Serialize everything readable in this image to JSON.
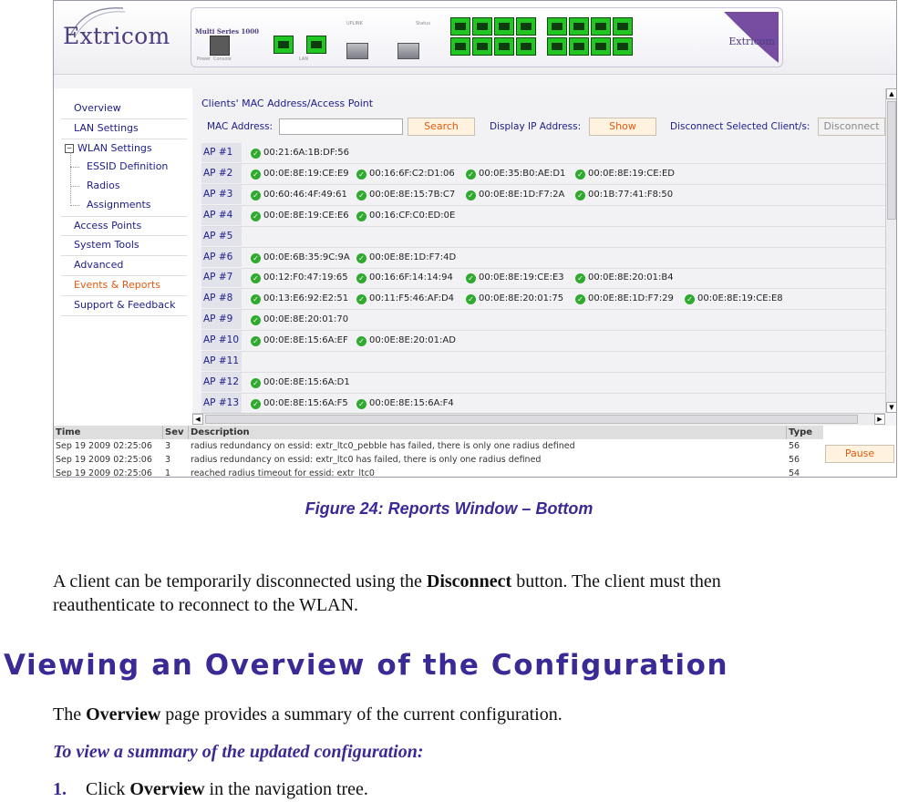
{
  "banner": {
    "logo": "Extricom",
    "device_title": "Multi Series 1000",
    "device_logo": "Extricom",
    "device_labels": [
      "Power",
      "Console",
      "LAN",
      "UPLINK",
      "Status"
    ]
  },
  "nav": {
    "items": [
      {
        "label": "Overview"
      },
      {
        "label": "LAN Settings"
      },
      {
        "label": "WLAN Settings"
      },
      {
        "label": "ESSID Definition"
      },
      {
        "label": "Radios"
      },
      {
        "label": "Assignments"
      },
      {
        "label": "Access Points"
      },
      {
        "label": "System Tools"
      },
      {
        "label": "Advanced"
      },
      {
        "label": "Events & Reports"
      },
      {
        "label": "Support & Feedback"
      }
    ],
    "tree_toggle": "−"
  },
  "panel": {
    "title": "Clients' MAC Address/Access Point",
    "mac_label": "MAC Address:",
    "mac_value": "",
    "search_label": "Search",
    "display_ip_label": "Display IP Address:",
    "show_label": "Show",
    "disconnect_label_text": "Disconnect Selected Client/s:",
    "disconnect_button": "Disconnect",
    "check_glyph": "✓"
  },
  "aps": [
    {
      "label": "AP #1",
      "macs": [
        "00:21:6A:1B:DF:56"
      ]
    },
    {
      "label": "AP #2",
      "macs": [
        "00:0E:8E:19:CE:E9",
        "00:16:6F:C2:D1:06",
        "00:0E:35:B0:AE:D1",
        "00:0E:8E:19:CE:ED"
      ]
    },
    {
      "label": "AP #3",
      "macs": [
        "00:60:46:4F:49:61",
        "00:0E:8E:15:7B:C7",
        "00:0E:8E:1D:F7:2A",
        "00:1B:77:41:F8:50"
      ]
    },
    {
      "label": "AP #4",
      "macs": [
        "00:0E:8E:19:CE:E6",
        "00:16:CF:C0:ED:0E"
      ]
    },
    {
      "label": "AP #5",
      "macs": []
    },
    {
      "label": "AP #6",
      "macs": [
        "00:0E:6B:35:9C:9A",
        "00:0E:8E:1D:F7:4D"
      ]
    },
    {
      "label": "AP #7",
      "macs": [
        "00:12:F0:47:19:65",
        "00:16:6F:14:14:94",
        "00:0E:8E:19:CE:E3",
        "00:0E:8E:20:01:B4"
      ]
    },
    {
      "label": "AP #8",
      "macs": [
        "00:13:E6:92:E2:51",
        "00:11:F5:46:AF:D4",
        "00:0E:8E:20:01:75",
        "00:0E:8E:1D:F7:29",
        "00:0E:8E:19:CE:E8"
      ]
    },
    {
      "label": "AP #9",
      "macs": [
        "00:0E:8E:20:01:70"
      ]
    },
    {
      "label": "AP #10",
      "macs": [
        "00:0E:8E:15:6A:EF",
        "00:0E:8E:20:01:AD"
      ]
    },
    {
      "label": "AP #11",
      "macs": []
    },
    {
      "label": "AP #12",
      "macs": [
        "00:0E:8E:15:6A:D1"
      ]
    },
    {
      "label": "AP #13",
      "macs": [
        "00:0E:8E:15:6A:F5",
        "00:0E:8E:15:6A:F4"
      ]
    }
  ],
  "log": {
    "headers": [
      "Time",
      "Sev",
      "Description",
      "Type"
    ],
    "rows": [
      {
        "time": "Sep 19 2009 02:25:06",
        "sev": "3",
        "desc": "radius redundancy on essid: extr_ltc0_pebble has failed, there is only one radius defined",
        "type": "56"
      },
      {
        "time": "Sep 19 2009 02:25:06",
        "sev": "3",
        "desc": "radius redundancy on essid: extr_ltc0 has failed, there is only one radius defined",
        "type": "56"
      },
      {
        "time": "Sep 19 2009 02:25:06",
        "sev": "1",
        "desc": "reached radius timeout for essid: extr_ltc0",
        "type": "54"
      }
    ],
    "pause_label": "Pause"
  },
  "doc": {
    "caption": "Figure 24: Reports Window – Bottom",
    "para_pre": "A client can be temporarily disconnected using the ",
    "para_bold": "Disconnect",
    "para_post": " button. The client must then",
    "para_line2": "reauthenticate to reconnect to the WLAN.",
    "heading": "Viewing an Overview of the Configuration",
    "overview_pre": "The ",
    "overview_bold": "Overview",
    "overview_post": " page provides a summary of the current configuration.",
    "procedure": "To view a summary of the updated configuration:",
    "step_number": "1.",
    "step_pre": "Click ",
    "step_bold": "Overview",
    "step_post": " in the navigation tree."
  }
}
